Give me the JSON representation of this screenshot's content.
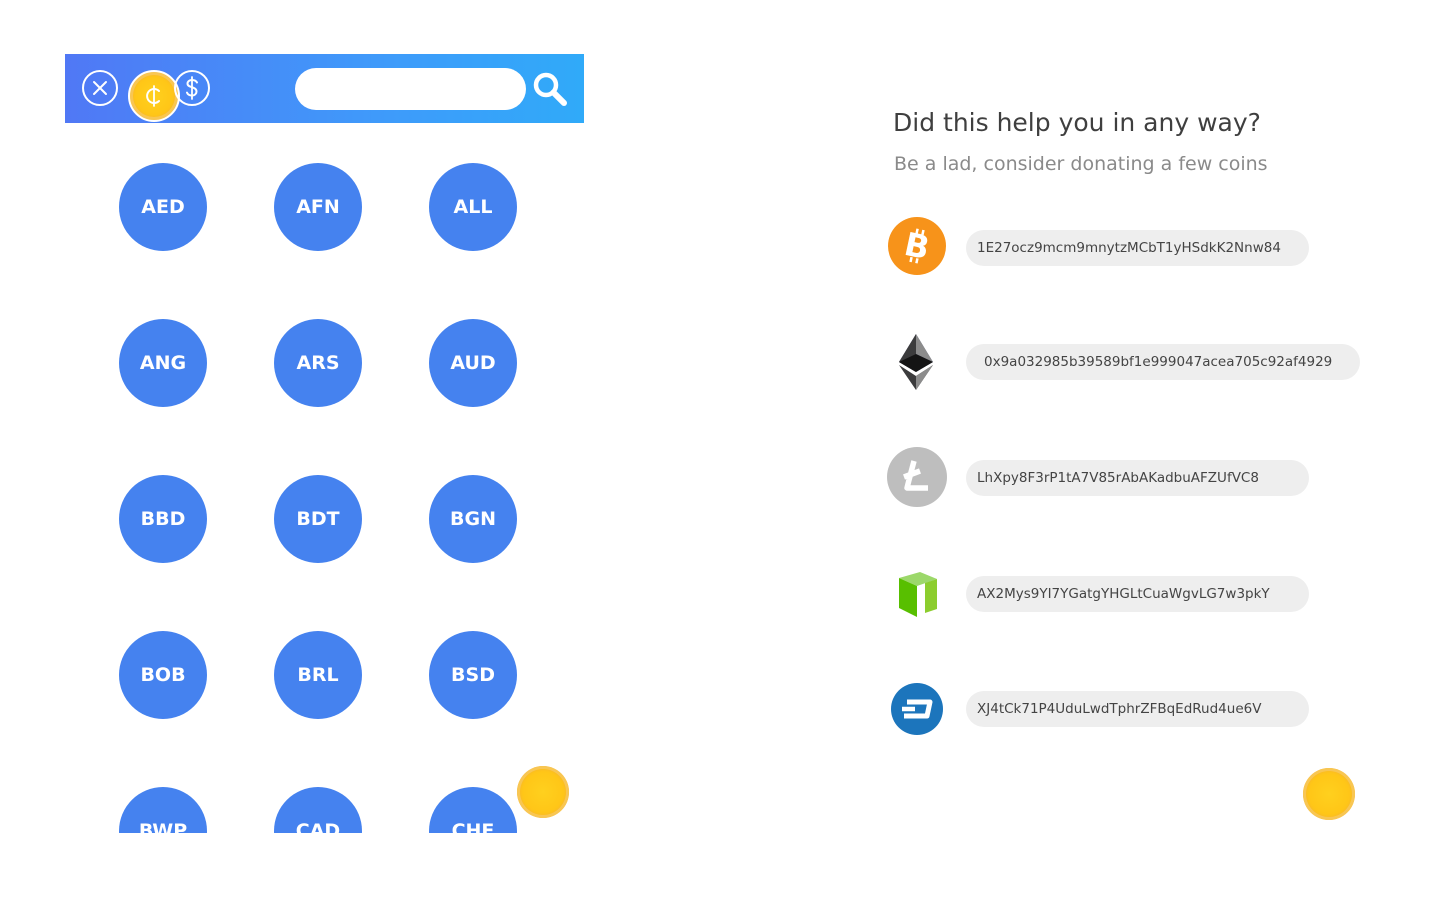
{
  "toolbar": {
    "buttons": [
      {
        "name": "close",
        "icon": "close-circle-icon"
      },
      {
        "name": "coin",
        "icon": "cedi-coin-icon"
      },
      {
        "name": "usd",
        "icon": "dollar-circle-icon"
      }
    ],
    "search": {
      "value": "",
      "placeholder": "",
      "icon": "search-icon"
    },
    "gradient": [
      "#5078f5",
      "#30aaf9"
    ]
  },
  "currencies": [
    "AED",
    "AFN",
    "ALL",
    "ANG",
    "ARS",
    "AUD",
    "BBD",
    "BDT",
    "BGN",
    "BOB",
    "BRL",
    "BSD",
    "BWP",
    "CAD",
    "CHF"
  ],
  "currency_color": "#4582ef",
  "donate": {
    "title": "Did this help you in any way?",
    "subtitle": "Be a lad, consider donating a few coins",
    "wallets": [
      {
        "coin": "bitcoin",
        "icon": "bitcoin-icon",
        "color": "#f7931a",
        "address": "1E27ocz9mcm9mnytzMCbT1yHSdkK2Nnw84"
      },
      {
        "coin": "ethereum",
        "icon": "ethereum-icon",
        "color": "#3c3c3d",
        "address": "0x9a032985b39589bf1e999047acea705c92af4929"
      },
      {
        "coin": "litecoin",
        "icon": "litecoin-icon",
        "color": "#bebebe",
        "address": "LhXpy8F3rP1tA7V85rAbAKadbuAFZUfVC8"
      },
      {
        "coin": "neo",
        "icon": "neo-icon",
        "color": "#58bf00",
        "address": "AX2Mys9YI7YGatgYHGLtCuaWgvLG7w3pkY"
      },
      {
        "coin": "dash",
        "icon": "dash-icon",
        "color": "#1c75bc",
        "address": "XJ4tCk71P4UduLwdTphrZFBqEdRud4ue6V"
      }
    ]
  },
  "decorations": [
    {
      "icon": "gold-coin-icon",
      "color": "#ffc617"
    },
    {
      "icon": "gold-coin-icon",
      "color": "#ffc617"
    }
  ]
}
